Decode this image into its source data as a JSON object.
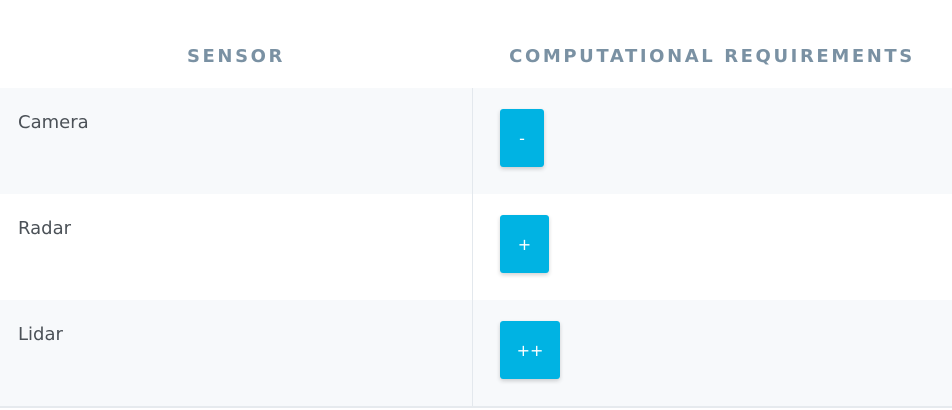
{
  "table": {
    "headers": {
      "sensor": "SENSOR",
      "requirements": "COMPUTATIONAL REQUIREMENTS"
    },
    "rows": [
      {
        "sensor": "Camera",
        "requirement": "-"
      },
      {
        "sensor": "Radar",
        "requirement": "+"
      },
      {
        "sensor": "Lidar",
        "requirement": "++"
      }
    ]
  },
  "colors": {
    "badge": "#00b3e3",
    "header_text": "#7a91a3",
    "row_alt_bg": "#f7f9fb"
  }
}
